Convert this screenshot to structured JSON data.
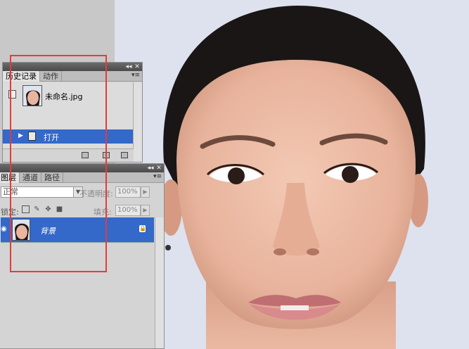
{
  "history_panel": {
    "tabs": [
      {
        "label": "历史记录",
        "active": true
      },
      {
        "label": "动作",
        "active": false
      }
    ],
    "snapshot": {
      "label": "未命名.jpg"
    },
    "steps": [
      {
        "label": "打开",
        "selected": true
      }
    ],
    "footer_icons": [
      "new-document-from-state-icon",
      "create-snapshot-icon",
      "trash-icon"
    ]
  },
  "layers_panel": {
    "tabs": [
      {
        "label": "图层",
        "active": true
      },
      {
        "label": "通道",
        "active": false
      },
      {
        "label": "路径",
        "active": false
      }
    ],
    "blend_mode": "正常",
    "opacity_label": "不透明度:",
    "opacity_value": "100%",
    "lock_label": "锁定:",
    "fill_label": "填充:",
    "fill_value": "100%",
    "layers": [
      {
        "name": "背景",
        "selected": true,
        "visible": true,
        "locked": true
      }
    ]
  },
  "colors": {
    "selection": "#3468c9",
    "highlight_box": "#e53b3b"
  }
}
